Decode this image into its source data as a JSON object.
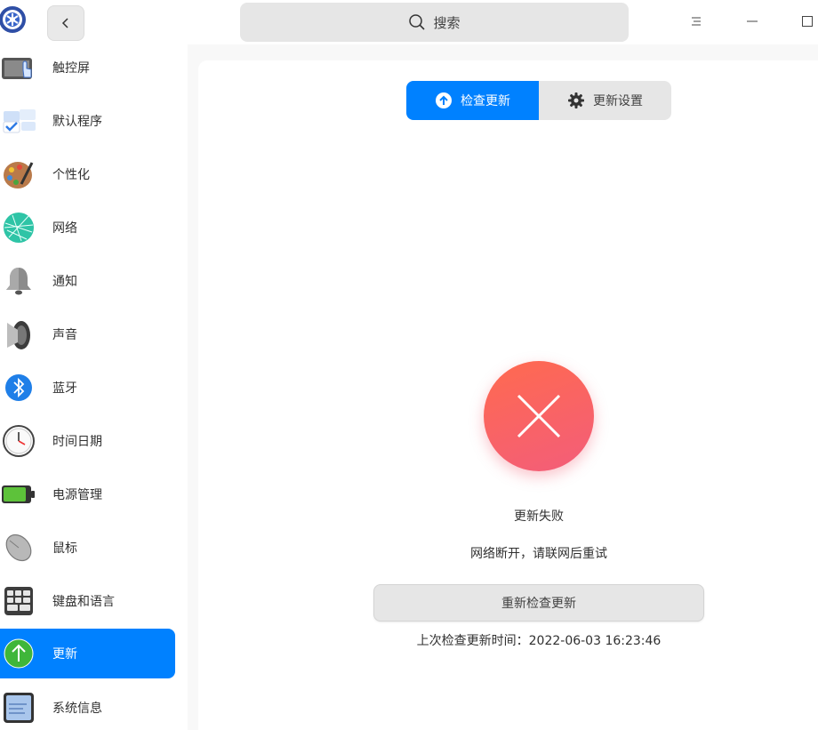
{
  "titlebar": {
    "search_placeholder": "搜索",
    "icons": {
      "logo": "control-center-logo",
      "back": "chevron-left-icon",
      "search": "search-icon",
      "menu": "menu-icon",
      "minimize": "minimize-icon",
      "maximize": "maximize-icon"
    }
  },
  "sidebar": {
    "items": [
      {
        "label": "触控屏",
        "icon": "touchscreen-icon",
        "active": false
      },
      {
        "label": "默认程序",
        "icon": "default-apps-icon",
        "active": false
      },
      {
        "label": "个性化",
        "icon": "palette-icon",
        "active": false
      },
      {
        "label": "网络",
        "icon": "network-globe-icon",
        "active": false
      },
      {
        "label": "通知",
        "icon": "bell-icon",
        "active": false
      },
      {
        "label": "声音",
        "icon": "speaker-icon",
        "active": false
      },
      {
        "label": "蓝牙",
        "icon": "bluetooth-icon",
        "active": false
      },
      {
        "label": "时间日期",
        "icon": "clock-icon",
        "active": false
      },
      {
        "label": "电源管理",
        "icon": "battery-icon",
        "active": false
      },
      {
        "label": "鼠标",
        "icon": "mouse-icon",
        "active": false
      },
      {
        "label": "键盘和语言",
        "icon": "keyboard-icon",
        "active": false
      },
      {
        "label": "更新",
        "icon": "update-arrow-icon",
        "active": true
      },
      {
        "label": "系统信息",
        "icon": "system-info-icon",
        "active": false
      }
    ]
  },
  "main": {
    "tabs": [
      {
        "label": "检查更新",
        "icon": "upload-circle-icon",
        "active": true
      },
      {
        "label": "更新设置",
        "icon": "gear-icon",
        "active": false
      }
    ],
    "status_icon": "error-x-icon",
    "status_title": "更新失败",
    "status_message": "网络断开，请联网后重试",
    "retry_label": "重新检查更新",
    "last_check_label": "上次检查更新时间：2022-06-03 16:23:46"
  },
  "colors": {
    "accent": "#0081ff",
    "error_start": "#ff6a4f",
    "error_end": "#f35d7a",
    "sidebar_bg": "#ffffff",
    "window_bg": "#f8f8f8"
  }
}
